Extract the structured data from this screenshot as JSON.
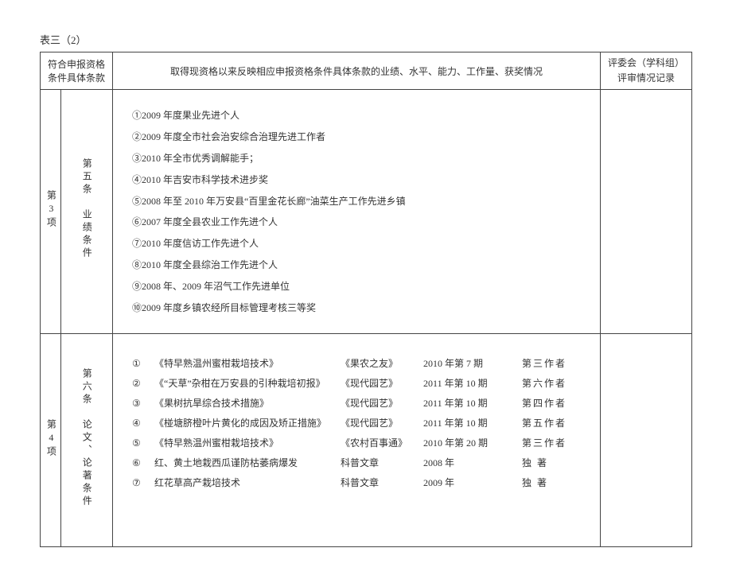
{
  "title": "表三（2）",
  "headers": {
    "cond": "符合申报资格条件具体条款",
    "desc": "取得现资格以来反映相应申报资格条件具体条款的业绩、水平、能力、工作量、获奖情况",
    "eval_l1": "评委会（学科组）",
    "eval_l2": "评审情况记录"
  },
  "row3": {
    "idx": "第3项",
    "sub": "第五条　业绩条件",
    "items": [
      "①2009 年度果业先进个人",
      "②2009 年度全市社会治安综合治理先进工作者",
      "③2010 年全市优秀调解能手；",
      "④2010 年吉安市科学技术进步奖",
      "⑤2008 年至 2010 年万安县“百里金花长廊”油菜生产工作先进乡镇",
      "⑥2007 年度全县农业工作先进个人",
      "⑦2010 年度信访工作先进个人",
      "⑧2010 年度全县综治工作先进个人",
      "⑨2008 年、2009 年沼气工作先进单位",
      "⑩2009 年度乡镇农经所目标管理考核三等奖"
    ]
  },
  "row4": {
    "idx": "第4项",
    "sub": "第六条　论文、论著条件",
    "pubs": [
      {
        "mk": "①",
        "title": "《特早熟温州蜜柑栽培技术》",
        "journal": "《果农之友》",
        "issue": "2010 年第 7 期",
        "author": "第三作者"
      },
      {
        "mk": "②",
        "title": "《“天草”杂柑在万安县的引种栽培初报》",
        "journal": "《现代园艺》",
        "issue": "2011 年第 10 期",
        "author": "第六作者"
      },
      {
        "mk": "③",
        "title": "《果树抗旱综合技术措施》",
        "journal": "《现代园艺》",
        "issue": "2011 年第 10 期",
        "author": "第四作者"
      },
      {
        "mk": "④",
        "title": "《椪塘脐橙叶片黄化的成因及矫正措施》",
        "journal": "《现代园艺》",
        "issue": "2011 年第 10 期",
        "author": "第五作者"
      },
      {
        "mk": "⑤",
        "title": "《特早熟温州蜜柑栽培技术》",
        "journal": "《农村百事通》",
        "issue": "2010 年第 20 期",
        "author": "第三作者"
      },
      {
        "mk": "⑥",
        "title": "红、黄土地栽西瓜谨防枯萎病爆发",
        "journal": "科普文章",
        "issue": "2008 年",
        "author": "独 著"
      },
      {
        "mk": "⑦",
        "title": "红花草高产栽培技术",
        "journal": "科普文章",
        "issue": "2009 年",
        "author": "独 著"
      }
    ]
  }
}
